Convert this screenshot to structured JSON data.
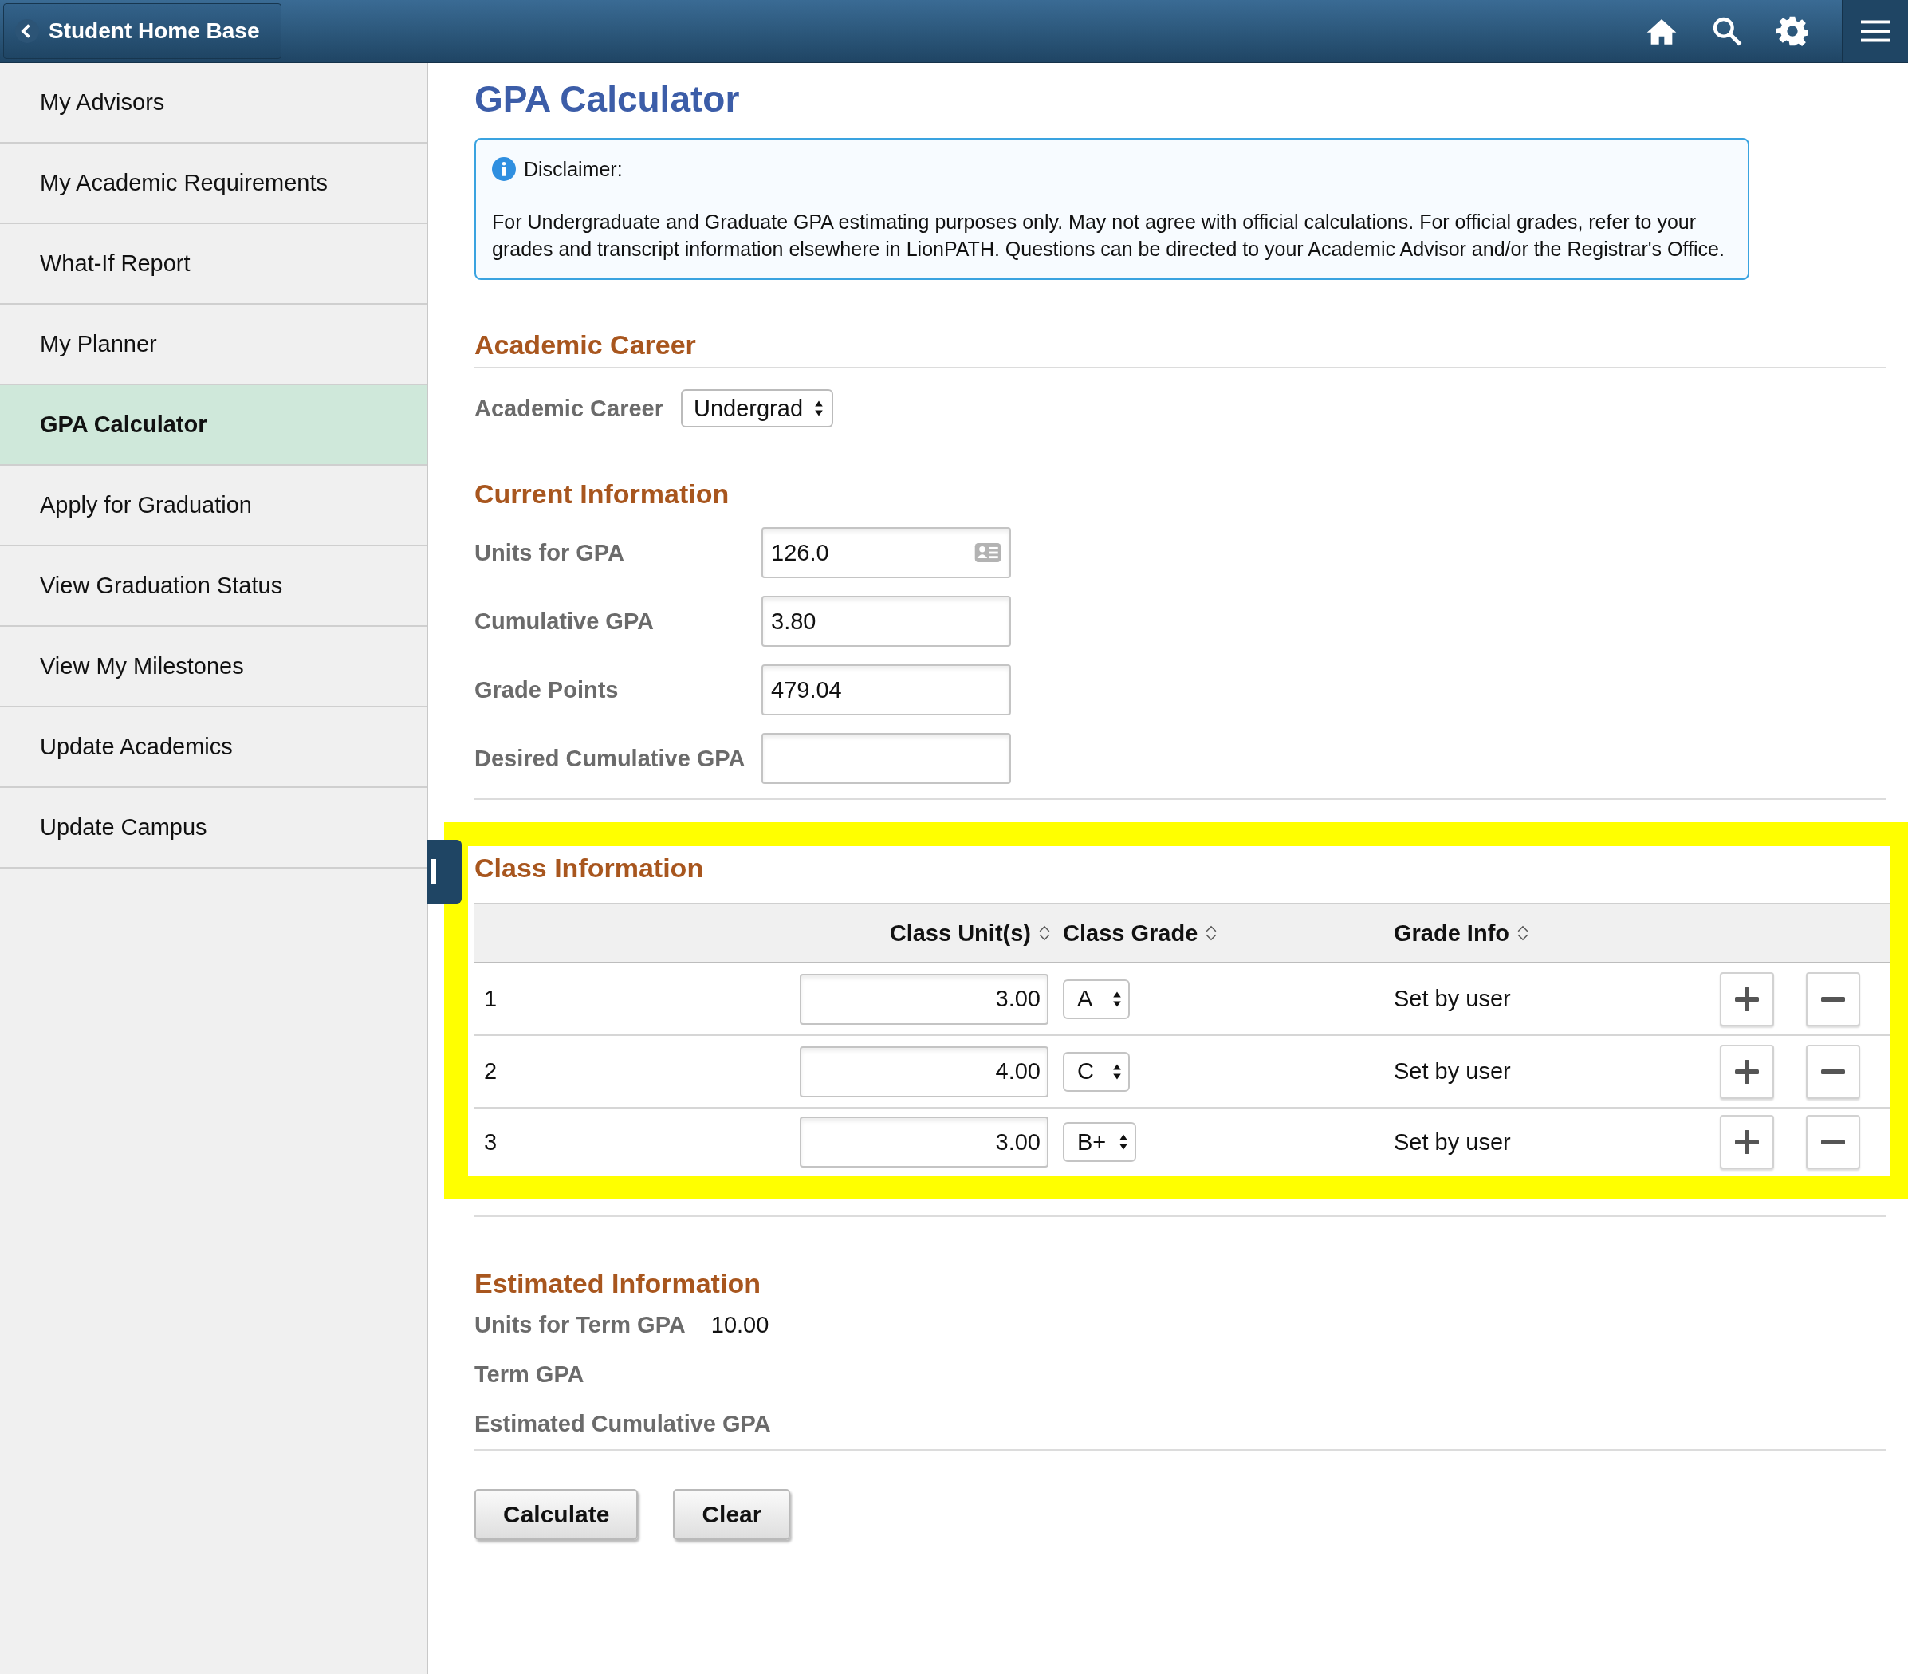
{
  "header": {
    "back_label": "Student Home Base"
  },
  "sidebar": {
    "items": [
      {
        "label": "My Advisors",
        "selected": false
      },
      {
        "label": "My Academic Requirements",
        "selected": false
      },
      {
        "label": "What-If Report",
        "selected": false
      },
      {
        "label": "My Planner",
        "selected": false
      },
      {
        "label": "GPA Calculator",
        "selected": true
      },
      {
        "label": "Apply for Graduation",
        "selected": false
      },
      {
        "label": "View Graduation Status",
        "selected": false
      },
      {
        "label": "View My Milestones",
        "selected": false
      },
      {
        "label": "Update Academics",
        "selected": false
      },
      {
        "label": "Update Campus",
        "selected": false
      }
    ]
  },
  "page_title": "GPA Calculator",
  "disclaimer": {
    "title": "Disclaimer:",
    "text": "For Undergraduate and Graduate GPA estimating purposes only. May not agree with official calculations. For official grades, refer to your grades and transcript information elsewhere in LionPATH. Questions can be directed to your Academic Advisor and/or the Registrar's Office."
  },
  "academic_career": {
    "heading": "Academic Career",
    "label": "Academic Career",
    "value": "Undergrad"
  },
  "current_information": {
    "heading": "Current Information",
    "fields": [
      {
        "label": "Units for GPA",
        "value": "126.0",
        "kind": "lookup"
      },
      {
        "label": "Cumulative GPA",
        "value": "3.80",
        "kind": "text"
      },
      {
        "label": "Grade Points",
        "value": "479.04",
        "kind": "text"
      },
      {
        "label": "Desired Cumulative GPA",
        "kind": "text"
      }
    ]
  },
  "class_information": {
    "heading": "Class Information",
    "columns": [
      "Class Unit(s)",
      "Class Grade",
      "Grade Info"
    ],
    "rows": [
      {
        "number": "1",
        "units": "3.00",
        "grade": "A",
        "grade_info": "Set by user"
      },
      {
        "number": "2",
        "units": "4.00",
        "grade": "C",
        "grade_info": "Set by user"
      },
      {
        "number": "3",
        "units": "3.00",
        "grade": "B+",
        "grade_info": "Set by user"
      }
    ]
  },
  "estimated_information": {
    "heading": "Estimated Information",
    "rows": [
      {
        "label": "Units for Term GPA",
        "value": "10.00"
      },
      {
        "label": "Term GPA"
      },
      {
        "label": "Estimated Cumulative GPA"
      }
    ]
  },
  "buttons": [
    "Calculate",
    "Clear"
  ]
}
